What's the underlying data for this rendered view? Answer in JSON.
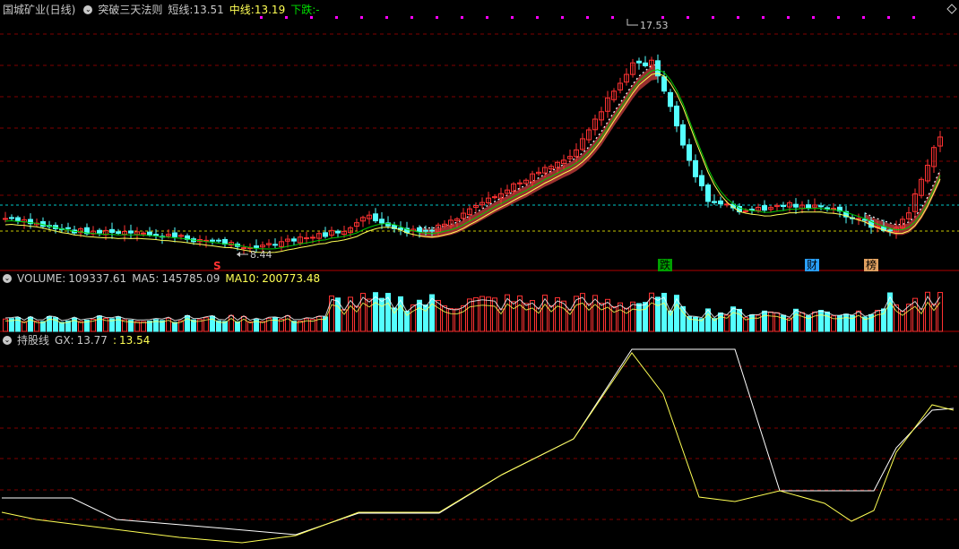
{
  "header": {
    "stock": "国城矿业(日线)",
    "indicator": "突破三天法则",
    "short_label": "短线:",
    "short_value": "13.51",
    "mid_label": "中线:",
    "mid_value": "13.19",
    "down_label": "下跌:",
    "down_value": "-"
  },
  "volume_header": {
    "vol_label": "VOLUME:",
    "vol_value": "109337.61",
    "ma5_label": "MA5:",
    "ma5_value": "145785.09",
    "ma10_label": "MA10:",
    "ma10_value": "200773.48"
  },
  "gx_header": {
    "name": "持股线",
    "gx_label": "GX:",
    "gx_value": "13.77",
    "sep": ":",
    "gx2_value": "13.54"
  },
  "annotations": {
    "high": "17.53",
    "low": "8.44",
    "s_mark": "S",
    "die": "跌",
    "cai": "财",
    "bang": "榜"
  },
  "colors": {
    "up": "#ff3232",
    "down": "#54ffff",
    "band": "#a03232",
    "ma_green": "#00c800",
    "ma_yellow": "#ffff54",
    "ref_cyan": "#00c8c8",
    "ref_yellow": "#c8c800",
    "grid": "#800000",
    "magenta": "#ff00ff"
  }
}
